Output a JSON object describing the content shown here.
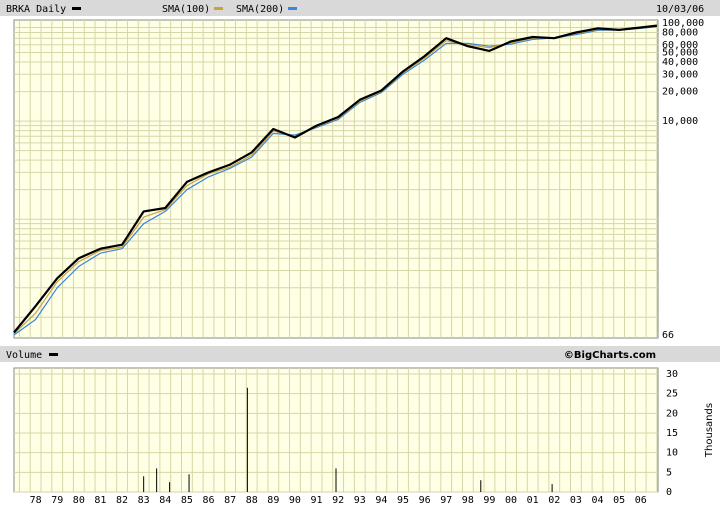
{
  "header": {
    "symbol_label": "BRKA Daily",
    "sma100_label": "SMA(100)",
    "sma200_label": "SMA(200)",
    "date": "10/03/06"
  },
  "volume_header": {
    "label": "Volume",
    "brand": "©BigCharts.com"
  },
  "colors": {
    "plot_bg": "#ffffe6",
    "grid": "#d6d6a8",
    "header_bg": "#d9d9d9",
    "price": "#000000",
    "sma100": "#c8a040",
    "sma200": "#3a88d8"
  },
  "chart_data": [
    {
      "type": "line",
      "scale": "log",
      "x": [
        1977,
        1978,
        1979,
        1980,
        1981,
        1982,
        1983,
        1984,
        1985,
        1986,
        1987,
        1988,
        1989,
        1990,
        1991,
        1992,
        1993,
        1994,
        1995,
        1996,
        1997,
        1998,
        1999,
        2000,
        2001,
        2002,
        2003,
        2004,
        2005,
        2006,
        2006.75
      ],
      "ylim": [
        66,
        100000
      ],
      "y_tick_labels": [
        "100,000",
        "80,000",
        "60,000",
        "50,000",
        "40,000",
        "30,000",
        "20,000",
        "10,000",
        "66"
      ],
      "y_tick_values": [
        100000,
        80000,
        60000,
        50000,
        40000,
        30000,
        20000,
        10000,
        66
      ],
      "x_tick_labels": [
        "78",
        "79",
        "80",
        "81",
        "82",
        "83",
        "84",
        "85",
        "86",
        "87",
        "88",
        "89",
        "90",
        "91",
        "92",
        "93",
        "94",
        "95",
        "96",
        "97",
        "98",
        "99",
        "00",
        "01",
        "02",
        "03",
        "04",
        "05",
        "06"
      ],
      "series": [
        {
          "name": "BRKA Daily",
          "values": [
            70,
            130,
            250,
            400,
            500,
            550,
            1200,
            1300,
            2400,
            3000,
            3600,
            4800,
            8300,
            6800,
            9000,
            11000,
            16500,
            20500,
            32000,
            46000,
            70000,
            58000,
            52000,
            65000,
            72000,
            70000,
            80000,
            88000,
            85000,
            90000,
            94000
          ]
        },
        {
          "name": "SMA(100)",
          "values": [
            68,
            110,
            230,
            370,
            480,
            520,
            1050,
            1250,
            2200,
            2900,
            3400,
            4500,
            7900,
            7000,
            8800,
            10700,
            16000,
            20000,
            31000,
            44000,
            66000,
            60000,
            56000,
            63000,
            70000,
            71000,
            78000,
            86000,
            85000,
            89000,
            93000
          ]
        },
        {
          "name": "SMA(200)",
          "values": [
            66,
            95,
            200,
            330,
            450,
            500,
            900,
            1200,
            2000,
            2700,
            3300,
            4300,
            7500,
            7200,
            8600,
            10400,
            15500,
            19500,
            30000,
            42000,
            62000,
            62000,
            58000,
            61000,
            68000,
            70500,
            76000,
            84000,
            85000,
            88000,
            92000
          ]
        }
      ]
    },
    {
      "type": "bar",
      "ylabel": "Thousands",
      "ylim": [
        0,
        30
      ],
      "y_tick_labels": [
        "30",
        "25",
        "20",
        "15",
        "10",
        "5",
        "0"
      ],
      "y_tick_values": [
        30,
        25,
        20,
        15,
        10,
        5,
        0
      ],
      "series": [
        {
          "name": "Volume",
          "x": [
            1983.0,
            1983.6,
            1984.2,
            1985.1,
            1987.8,
            1991.9,
            1998.6,
            2001.9
          ],
          "values": [
            4,
            6,
            2.5,
            4.5,
            26.5,
            6,
            3,
            2
          ]
        }
      ]
    }
  ]
}
